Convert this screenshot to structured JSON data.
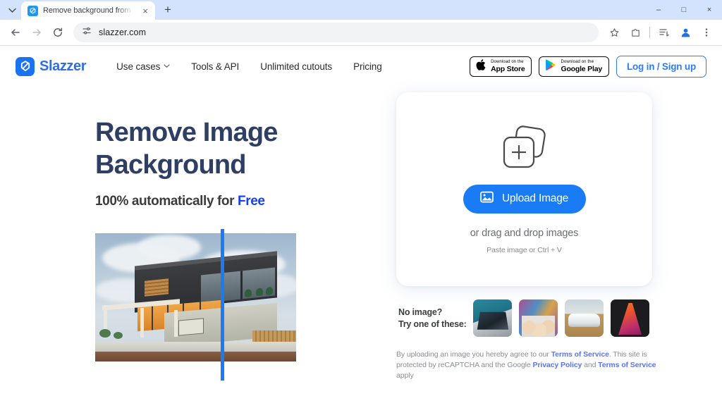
{
  "browser": {
    "tab": {
      "title": "Remove background from imag",
      "favicon_name": "slazzer-favicon",
      "close_label": "×"
    },
    "new_tab_label": "+",
    "tab_search_label": "∨",
    "window_controls": {
      "minimize": "–",
      "maximize": "□",
      "close": "×"
    },
    "toolbar": {
      "back_label": "←",
      "forward_label": "→",
      "reload_label": "⟳",
      "site_settings_icon": "tune-icon",
      "url": "slazzer.com",
      "bookmark_icon": "star-icon",
      "extensions_icon": "puzzle-icon",
      "reading_list_icon": "reading-list-icon",
      "profile_icon": "profile-avatar-icon",
      "menu_icon": "three-dots-icon"
    }
  },
  "site": {
    "brand": {
      "name": "Slazzer",
      "mark_icon": "slazzer-logo-icon",
      "color": "#2f6fe4"
    },
    "nav": [
      {
        "label": "Use cases",
        "has_caret": true,
        "caret": "⌄"
      },
      {
        "label": "Tools & API",
        "has_caret": false
      },
      {
        "label": "Unlimited cutouts",
        "has_caret": false
      },
      {
        "label": "Pricing",
        "has_caret": false
      }
    ],
    "store_badges": [
      {
        "icon": "apple-icon",
        "small": "Download on the",
        "big": "App Store"
      },
      {
        "icon": "google-play-icon",
        "small": "Download on the",
        "big": "Google Play"
      }
    ],
    "login_button": "Log in / Sign up"
  },
  "hero": {
    "title_line1": "Remove Image",
    "title_line2": "Background",
    "subtitle_prefix": "100% automatically for ",
    "subtitle_accent": "Free",
    "accent_color": "#1740f0",
    "preview_image_alt": "modern house before and after background removal",
    "slider_color": "#1a7cf5"
  },
  "upload": {
    "stack_icon": "image-stack-plus-icon",
    "button_icon": "image-icon",
    "button_label": "Upload Image",
    "button_color": "#1a7cf5",
    "drag_text": "or drag and drop images",
    "paste_text": "Paste image or Ctrl + V"
  },
  "samples": {
    "label_line1": "No image?",
    "label_line2": "Try one of these:",
    "thumbnails": [
      {
        "name": "laptop-sample"
      },
      {
        "name": "girls-selfie-sample"
      },
      {
        "name": "white-car-sample"
      },
      {
        "name": "orange-dress-sample"
      }
    ]
  },
  "legal": {
    "part1": "By uploading an image you hereby agree to our ",
    "link1": "Terms of Service",
    "part2": ". This site is protected by reCAPTCHA and the Google ",
    "link2": "Privacy Policy",
    "part3": " and ",
    "link3": "Terms of Service",
    "part4": " apply"
  }
}
